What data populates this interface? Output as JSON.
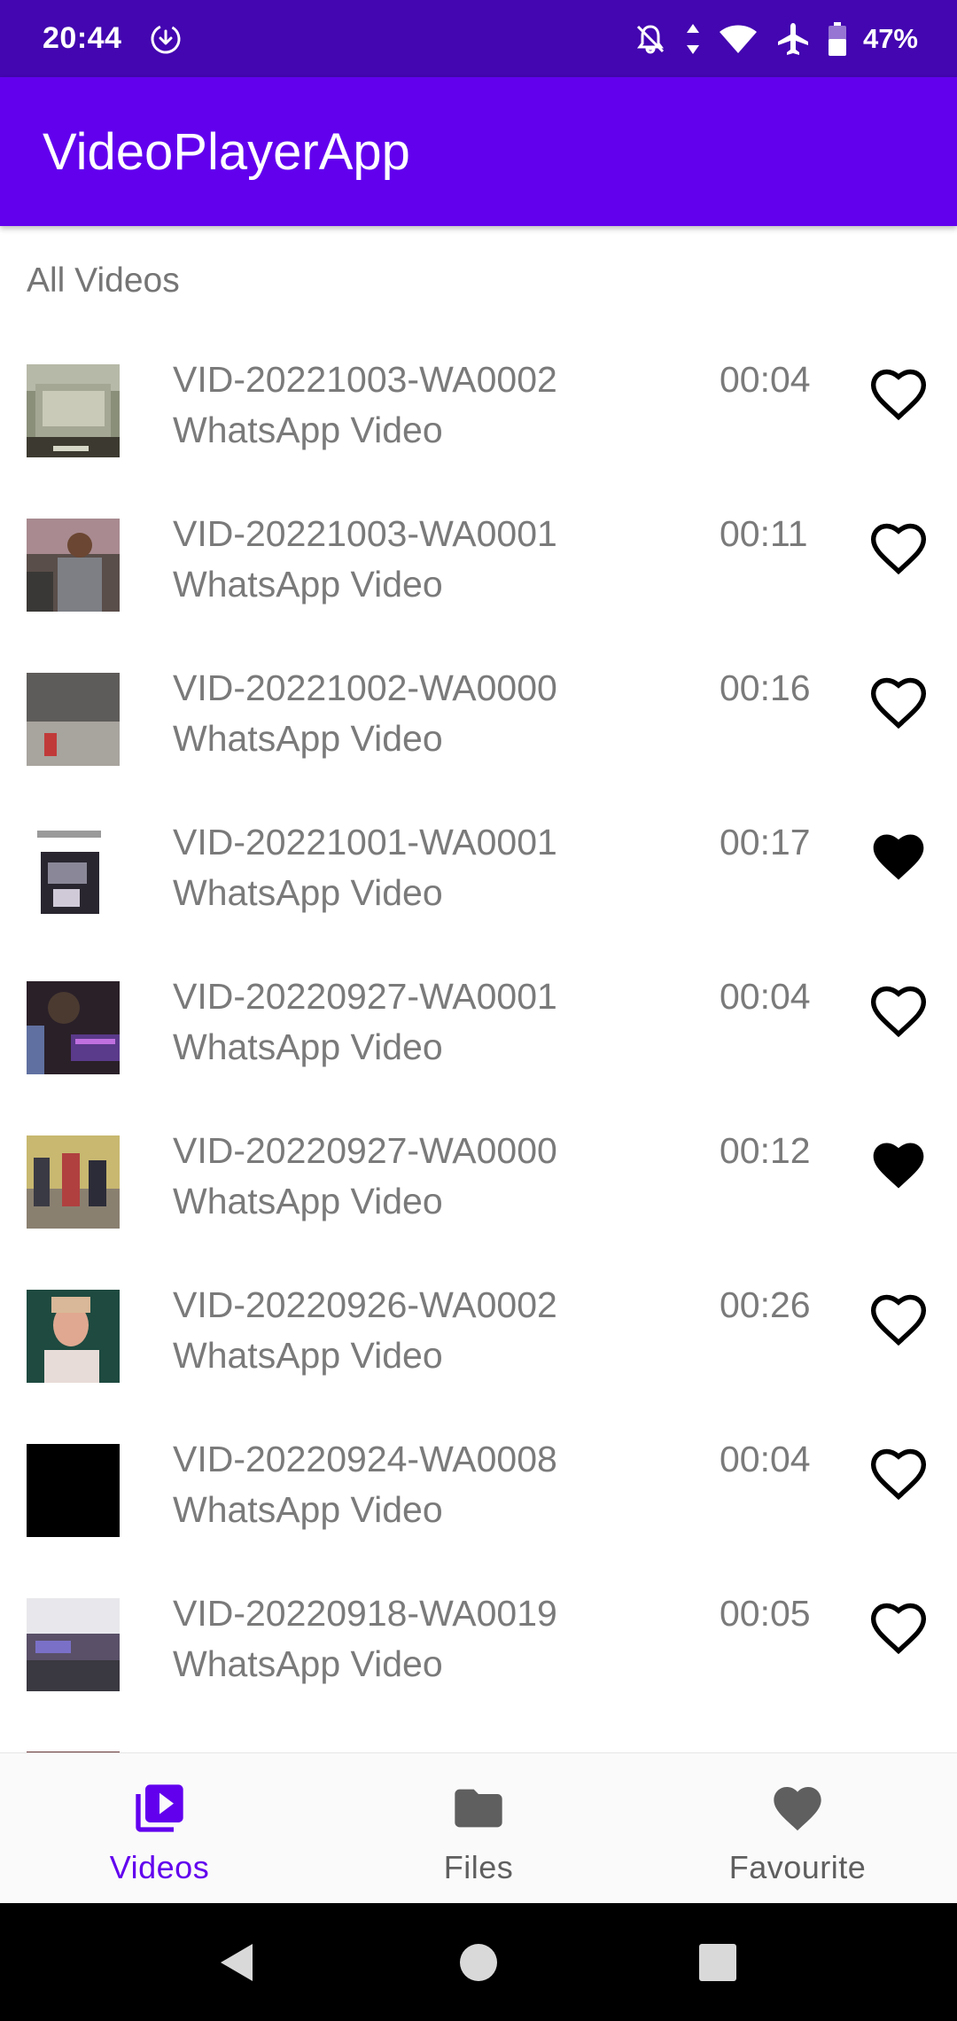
{
  "status_bar": {
    "time": "20:44",
    "battery": "47%",
    "icons": [
      "download-icon",
      "notifications-off-icon",
      "data-arrows-icon",
      "wifi-icon",
      "airplane-icon",
      "battery-icon"
    ]
  },
  "app_bar": {
    "title": "VideoPlayerApp"
  },
  "section_label": "All Videos",
  "videos": [
    {
      "title": "VID-20221003-WA0002",
      "subtitle": "WhatsApp Video",
      "duration": "00:04",
      "favourite": false
    },
    {
      "title": "VID-20221003-WA0001",
      "subtitle": "WhatsApp Video",
      "duration": "00:11",
      "favourite": false
    },
    {
      "title": "VID-20221002-WA0000",
      "subtitle": "WhatsApp Video",
      "duration": "00:16",
      "favourite": false
    },
    {
      "title": "VID-20221001-WA0001",
      "subtitle": "WhatsApp Video",
      "duration": "00:17",
      "favourite": true
    },
    {
      "title": "VID-20220927-WA0001",
      "subtitle": "WhatsApp Video",
      "duration": "00:04",
      "favourite": false
    },
    {
      "title": "VID-20220927-WA0000",
      "subtitle": "WhatsApp Video",
      "duration": "00:12",
      "favourite": true
    },
    {
      "title": "VID-20220926-WA0002",
      "subtitle": "WhatsApp Video",
      "duration": "00:26",
      "favourite": false
    },
    {
      "title": "VID-20220924-WA0008",
      "subtitle": "WhatsApp Video",
      "duration": "00:04",
      "favourite": false
    },
    {
      "title": "VID-20220918-WA0019",
      "subtitle": "WhatsApp Video",
      "duration": "00:05",
      "favourite": false
    }
  ],
  "bottom_nav": {
    "items": [
      {
        "label": "Videos",
        "icon": "video-library-icon",
        "active": true
      },
      {
        "label": "Files",
        "icon": "folder-icon",
        "active": false
      },
      {
        "label": "Favourite",
        "icon": "heart-icon",
        "active": false
      }
    ]
  },
  "colors": {
    "status_bar": "#4306b0",
    "app_bar": "#6200ee",
    "accent": "#6200ee",
    "text_secondary": "#7a7a7a",
    "nav_inactive": "#5f5f5f"
  }
}
